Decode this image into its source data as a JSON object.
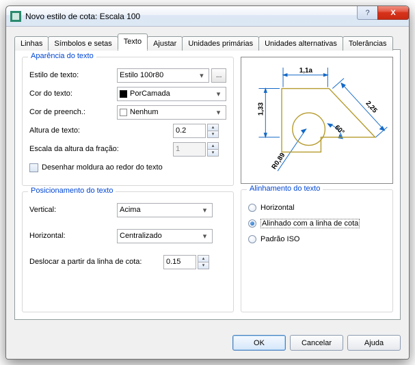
{
  "window": {
    "title": "Novo estilo de cota: Escala 100"
  },
  "tabs": {
    "linhas": "Linhas",
    "simbolos": "Símbolos e setas",
    "texto": "Texto",
    "ajustar": "Ajustar",
    "primarias": "Unidades primárias",
    "alternativas": "Unidades alternativas",
    "tolerancias": "Tolerâncias"
  },
  "appearance": {
    "legend": "Aparência do texto",
    "style_label": "Estilo de texto:",
    "style_value": "Estilo 100r80",
    "color_label": "Cor do texto:",
    "color_value": "PorCamada",
    "fill_label": "Cor de preench.:",
    "fill_value": "Nenhum",
    "height_label": "Altura de texto:",
    "height_value": "0.2",
    "fraction_label": "Escala da altura da fração:",
    "fraction_value": "1",
    "frame_check": "Desenhar moldura ao redor do texto"
  },
  "position": {
    "legend": "Posicionamento do texto",
    "vertical_label": "Vertical:",
    "vertical_value": "Acima",
    "horizontal_label": "Horizontal:",
    "horizontal_value": "Centralizado",
    "offset_label": "Deslocar a partir da linha de cota:",
    "offset_value": "0.15"
  },
  "alignment": {
    "legend": "Alinhamento do texto",
    "horizontal": "Horizontal",
    "aligned": "Alinhado com a linha de cota",
    "iso": "Padrão ISO"
  },
  "preview": {
    "dim1": "1,1a",
    "dim2": "1,33",
    "dim3": "2,25",
    "dim4": "R0,89",
    "dim5": "60°"
  },
  "buttons": {
    "ok": "OK",
    "cancel": "Cancelar",
    "help": "Ajuda",
    "ellipsis": "..."
  },
  "glyphs": {
    "down": "▾",
    "up": "▴",
    "help": "?",
    "close": "X"
  }
}
